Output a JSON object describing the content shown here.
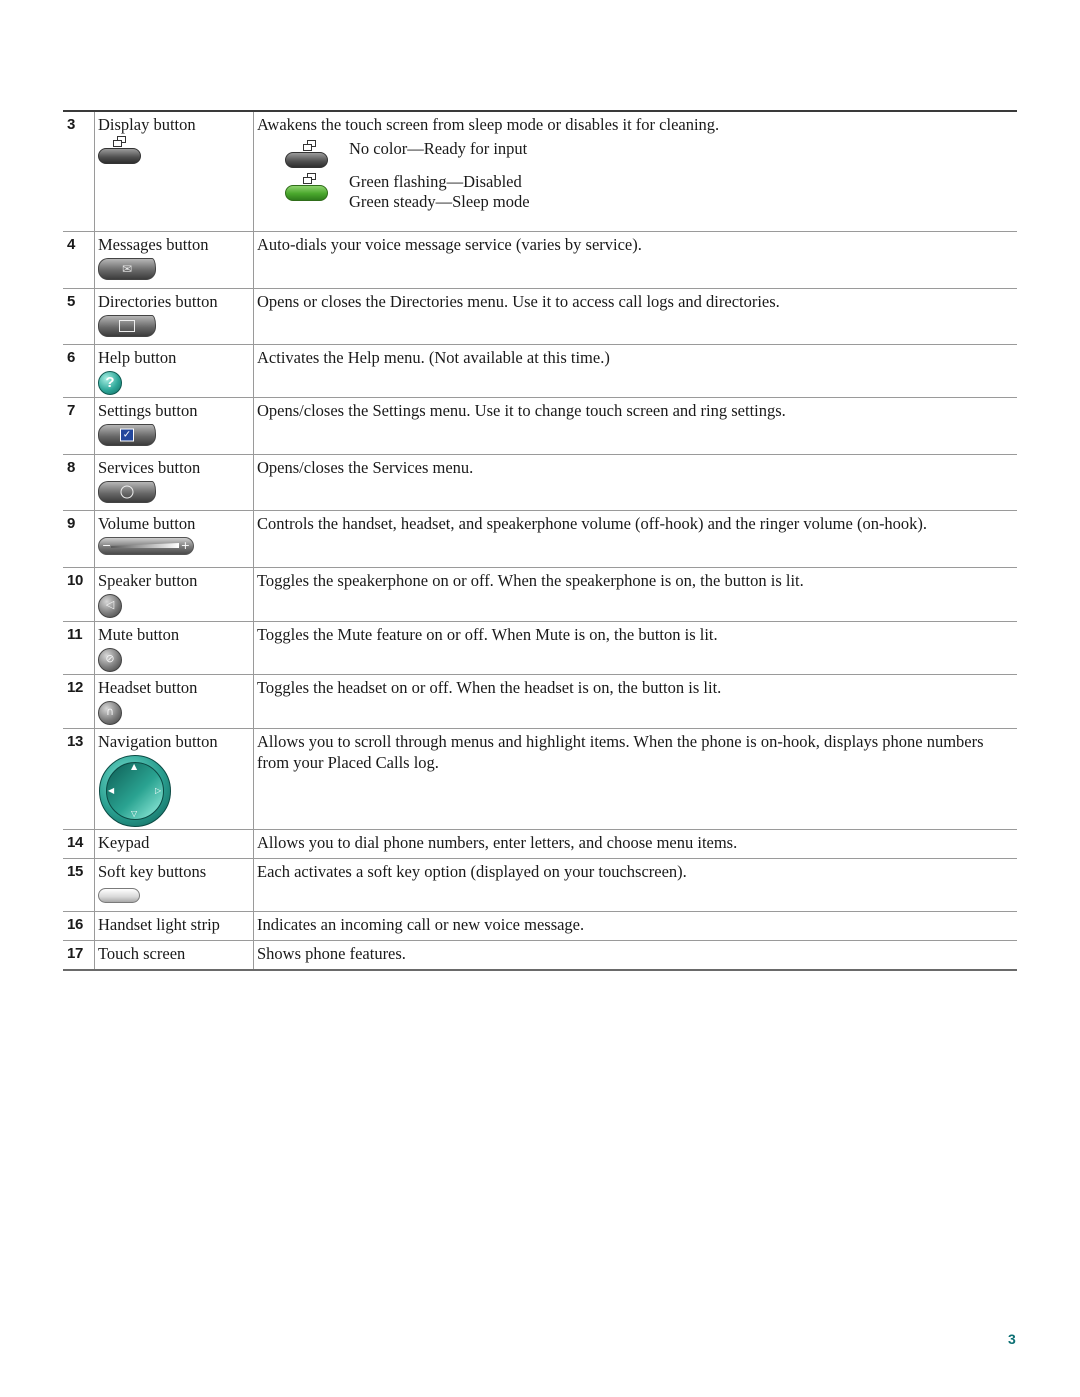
{
  "table": {
    "rows": [
      {
        "num": "3",
        "name": "Display button",
        "icon": "display-button-icon",
        "description": "Awakens the touch screen from sleep mode or disables it for cleaning.",
        "states": [
          {
            "icon": "display-button-gray-icon",
            "label": "No color—Ready for input"
          },
          {
            "icon": "display-button-green-icon",
            "label": "Green flashing—Disabled"
          },
          {
            "icon": "",
            "label": "Green steady—Sleep mode"
          }
        ]
      },
      {
        "num": "4",
        "name": "Messages button",
        "icon": "envelope-icon",
        "description": "Auto-dials your voice message service (varies by service)."
      },
      {
        "num": "5",
        "name": "Directories button",
        "icon": "book-icon",
        "description": "Opens or closes the Directories menu. Use it to access call logs and directories."
      },
      {
        "num": "6",
        "name": "Help button",
        "icon": "question-mark-icon",
        "description": "Activates the Help menu. (Not available at this time.)"
      },
      {
        "num": "7",
        "name": "Settings button",
        "icon": "checkbox-icon",
        "description": "Opens/closes the Settings menu. Use it to change touch screen and ring settings."
      },
      {
        "num": "8",
        "name": "Services button",
        "icon": "globe-icon",
        "description": "Opens/closes the Services menu."
      },
      {
        "num": "9",
        "name": "Volume button",
        "icon": "volume-rocker-icon",
        "description": "Controls the handset, headset, and speakerphone volume (off-hook) and the ringer volume (on-hook)."
      },
      {
        "num": "10",
        "name": "Speaker button",
        "icon": "speaker-icon",
        "description": "Toggles the speakerphone on or off. When the speakerphone is on, the button is lit."
      },
      {
        "num": "11",
        "name": "Mute button",
        "icon": "mute-microphone-icon",
        "description": "Toggles the Mute feature on or off. When Mute is on, the button is lit."
      },
      {
        "num": "12",
        "name": "Headset button",
        "icon": "headset-icon",
        "description": "Toggles the headset on or off. When the headset is on, the button is lit."
      },
      {
        "num": "13",
        "name": "Navigation button",
        "icon": "navigation-pad-icon",
        "description": "Allows you to scroll through menus and highlight items. When the phone is on-hook, displays phone numbers from your Placed Calls log."
      },
      {
        "num": "14",
        "name": "Keypad",
        "icon": "",
        "description": "Allows you to dial phone numbers, enter letters, and choose menu items."
      },
      {
        "num": "15",
        "name": "Soft key buttons",
        "icon": "soft-key-icon",
        "description": "Each activates a soft key option (displayed on your touchscreen)."
      },
      {
        "num": "16",
        "name": "Handset light strip",
        "icon": "",
        "description": "Indicates an incoming call or new voice message."
      },
      {
        "num": "17",
        "name": "Touch screen",
        "icon": "",
        "description": "Shows phone features."
      }
    ]
  },
  "glyphs": {
    "envelope": "✉",
    "book": "🕮",
    "question": "?",
    "check": "✓",
    "globe": "◐",
    "minus": "−",
    "plus": "+",
    "speaker": "◁",
    "mute": "⊘",
    "headset": "∩",
    "arrow_up": "▲",
    "arrow_down": "▽",
    "arrow_left": "◀",
    "arrow_right": "▷"
  },
  "colors": {
    "page_number": "#0d7074",
    "green_state": "#49a72c",
    "help_teal": "#2fa89a",
    "nav_teal": "#2a9f90"
  },
  "footer": {
    "page_number": "3"
  }
}
